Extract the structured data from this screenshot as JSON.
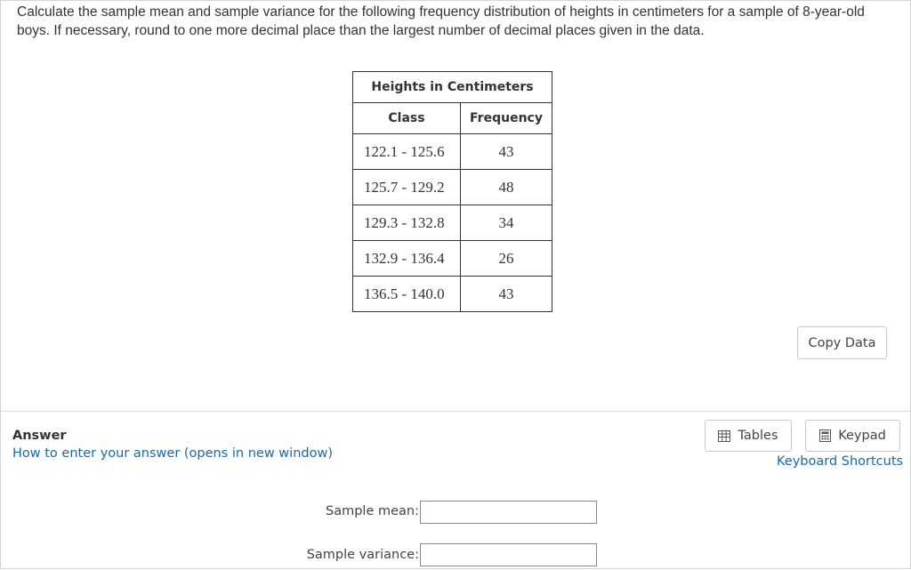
{
  "question": {
    "text": "Calculate the sample mean and sample variance for the following frequency distribution of heights in centimeters for a sample of 8-year-old boys. If necessary, round to one more decimal place than the largest number of decimal places given in the data."
  },
  "table": {
    "title": "Heights in Centimeters",
    "headers": [
      "Class",
      "Frequency"
    ],
    "rows": [
      {
        "class": "122.1 - 125.6",
        "frequency": "43"
      },
      {
        "class": "125.7 - 129.2",
        "frequency": "48"
      },
      {
        "class": "129.3 - 132.8",
        "frequency": "34"
      },
      {
        "class": "132.9 - 136.4",
        "frequency": "26"
      },
      {
        "class": "136.5 - 140.0",
        "frequency": "43"
      }
    ]
  },
  "buttons": {
    "copy_data": "Copy Data",
    "tables": "Tables",
    "keypad": "Keypad"
  },
  "answer": {
    "label": "Answer",
    "how_link": "How to enter your answer (opens in new window)",
    "shortcuts_link": "Keyboard Shortcuts",
    "mean_label": "Sample mean:",
    "variance_label": "Sample variance:",
    "mean_value": "",
    "variance_value": ""
  },
  "icons": {
    "tables": "table-grid-icon",
    "keypad": "calculator-icon"
  },
  "colors": {
    "link": "#1a6aa8",
    "border": "#d4d4d4"
  }
}
